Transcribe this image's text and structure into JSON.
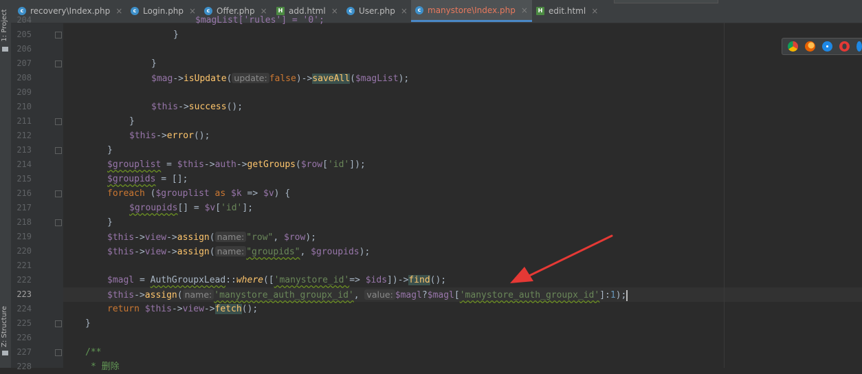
{
  "sidebar": {
    "project_label": "1: Project",
    "structure_label": "Z: Structure"
  },
  "tabs": [
    {
      "label": "recovery\\Index.php",
      "icon": "php-class-icon",
      "active": false
    },
    {
      "label": "Login.php",
      "icon": "php-class-icon",
      "active": false
    },
    {
      "label": "Offer.php",
      "icon": "php-class-icon",
      "active": false
    },
    {
      "label": "add.html",
      "icon": "html-file-icon",
      "active": false
    },
    {
      "label": "User.php",
      "icon": "php-class-icon",
      "active": false
    },
    {
      "label": "manystore\\Index.php",
      "icon": "php-class-icon",
      "active": true
    },
    {
      "label": "edit.html",
      "icon": "html-file-icon",
      "active": false
    }
  ],
  "tab_close_glyph": "×",
  "line_numbers": [
    "204",
    "205",
    "206",
    "207",
    "208",
    "209",
    "210",
    "211",
    "212",
    "213",
    "214",
    "215",
    "216",
    "217",
    "218",
    "219",
    "220",
    "221",
    "222",
    "223",
    "224",
    "225",
    "226",
    "227",
    "228"
  ],
  "current_line": "223",
  "code": {
    "l204": "$magList['rules'] = '0';",
    "l205": "}",
    "l207": "}",
    "l208_obj": "$mag",
    "l208_arrow": "->",
    "l208_fn": "isUpdate",
    "l208_open": "(",
    "l208_hint": "update:",
    "l208_arg": "false",
    "l208_mid": ")->",
    "l208_fn2": "saveAll",
    "l208_p1": "(",
    "l208_var": "$magList",
    "l208_end": ");",
    "l210_this": "$this",
    "l210_arrow": "->",
    "l210_fn": "success",
    "l210_end": "();",
    "l211": "}",
    "l212_this": "$this",
    "l212_arrow": "->",
    "l212_fn": "error",
    "l212_end": "();",
    "l213": "}",
    "l214_var": "$grouplist",
    "l214_eq": " = ",
    "l214_this": "$this",
    "l214_a1": "->",
    "l214_auth": "auth",
    "l214_a2": "->",
    "l214_fn": "getGroups",
    "l214_p": "(",
    "l214_row": "$row",
    "l214_b1": "[",
    "l214_str": "'id'",
    "l214_end": "]);",
    "l215_var": "$groupids",
    "l215_end": " = [];",
    "l216_kw": "foreach",
    "l216_p": " (",
    "l216_v1": "$grouplist",
    "l216_as": " as ",
    "l216_k": "$k",
    "l216_arr": " => ",
    "l216_v": "$v",
    "l216_end": ") {",
    "l217_var": "$groupids",
    "l217_mid": "[] = ",
    "l217_v": "$v",
    "l217_b": "[",
    "l217_str": "'id'",
    "l217_end": "];",
    "l218": "}",
    "l219_this": "$this",
    "l219_a1": "->",
    "l219_view": "view",
    "l219_a2": "->",
    "l219_fn": "assign",
    "l219_p": "(",
    "l219_hint": "name:",
    "l219_str": "\"row\"",
    "l219_c": ", ",
    "l219_row": "$row",
    "l219_end": ");",
    "l220_this": "$this",
    "l220_a1": "->",
    "l220_view": "view",
    "l220_a2": "->",
    "l220_fn": "assign",
    "l220_p": "(",
    "l220_hint": "name:",
    "l220_str": "\"groupids\"",
    "l220_c": ", ",
    "l220_var": "$groupids",
    "l220_end": ");",
    "l222_var": "$magl",
    "l222_eq": " = ",
    "l222_cls": "AuthGroupxLead",
    "l222_dc": "::",
    "l222_fn": "where",
    "l222_p": "([",
    "l222_str": "'manystore_id'",
    "l222_arr": "=> ",
    "l222_ids": "$ids",
    "l222_mid": "])->",
    "l222_fn2": "find",
    "l222_end": "();",
    "l223_this": "$this",
    "l223_a": "->",
    "l223_fn": "assign",
    "l223_p": "(",
    "l223_hint1": "name:",
    "l223_str1": "'manystore_auth_groupx_id'",
    "l223_c": ", ",
    "l223_hint2": "value:",
    "l223_magl": "$magl",
    "l223_q": "?",
    "l223_magl2": "$magl",
    "l223_b": "[",
    "l223_str2": "'manystore_auth_groupx_id'",
    "l223_b2": "]:",
    "l223_num": "1",
    "l223_end": ");",
    "l224_kw": "return ",
    "l224_this": "$this",
    "l224_a1": "->",
    "l224_view": "view",
    "l224_a2": "->",
    "l224_fn": "fetch",
    "l224_end": "();",
    "l225": "}",
    "l227": "/**",
    "l228": "* 删除"
  },
  "browser_icons": [
    "chrome-icon",
    "firefox-icon",
    "safari-icon",
    "opera-icon",
    "ie-icon"
  ],
  "colors": {
    "background": "#2b2b2b",
    "variable": "#9876aa",
    "keyword": "#cc7832",
    "function": "#ffc66d",
    "string": "#6a8759",
    "arrow_annotation": "#e53935",
    "active_tab_accent": "#4a88c7"
  }
}
